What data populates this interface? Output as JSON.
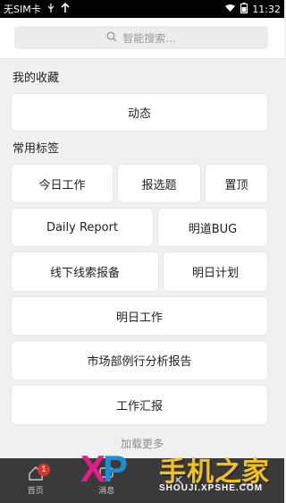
{
  "status_bar": {
    "carrier": "无SIM卡",
    "time": "11:32"
  },
  "search": {
    "placeholder": "智能搜索..."
  },
  "favorites": {
    "title": "我的收藏",
    "items": [
      "动态"
    ]
  },
  "common_tags": {
    "title": "常用标签",
    "items": [
      "今日工作",
      "报选题",
      "置顶",
      "Daily Report",
      "明道BUG",
      "线下线索报备",
      "明日计划",
      "明日工作",
      "市场部例行分析报告",
      "工作汇报"
    ]
  },
  "load_more": "加载更多",
  "tab_bar": {
    "items": [
      {
        "label": "首页",
        "icon": "home-icon",
        "badge": "1"
      },
      {
        "label": "消息",
        "icon": "message-icon"
      },
      {
        "label": "",
        "icon": "close-icon"
      },
      {
        "label": "",
        "icon": "menu-icon"
      }
    ]
  },
  "watermark": {
    "logo": "XP",
    "title": "手机之家",
    "url": "SHOUJI.XPSHE.COM"
  },
  "colors": {
    "background": "#f0f0f0",
    "tabbar": "#3a3a3a",
    "badge": "#d9352c"
  }
}
